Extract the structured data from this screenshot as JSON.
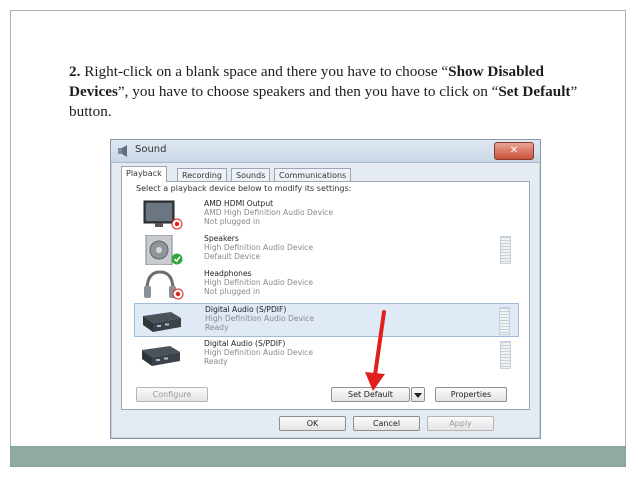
{
  "slide": {
    "caption": {
      "step_number": "2.",
      "part1": " Right-click on a blank space and there you have to choose “",
      "bold1": "Show Disabled Devices",
      "part2": "”, you have to choose speakers and then you have to click on “",
      "bold2": "Set Default",
      "part3": "” button."
    }
  },
  "dialog": {
    "title": "Sound",
    "close_label": "✕",
    "tabs": [
      {
        "label": "Playback",
        "active": true
      },
      {
        "label": "Recording",
        "active": false
      },
      {
        "label": "Sounds",
        "active": false
      },
      {
        "label": "Communications",
        "active": false
      }
    ],
    "instruction": "Select a playback device below to modify its settings:",
    "devices": [
      {
        "name": "AMD HDMI Output",
        "driver": "AMD High Definition Audio Device",
        "status": "Not plugged in",
        "icon": "monitor-icon",
        "badge": "red-down-arrow"
      },
      {
        "name": "Speakers",
        "driver": "High Definition Audio Device",
        "status": "Default Device",
        "icon": "speaker-icon",
        "badge": "green-check"
      },
      {
        "name": "Headphones",
        "driver": "High Definition Audio Device",
        "status": "Not plugged in",
        "icon": "headphones-icon",
        "badge": "red-down-arrow"
      },
      {
        "name": "Digital Audio (S/PDIF)",
        "driver": "High Definition Audio Device",
        "status": "Ready",
        "icon": "digital-audio-icon",
        "badge": "",
        "selected": true
      },
      {
        "name": "Digital Audio (S/PDIF)",
        "driver": "High Definition Audio Device",
        "status": "Ready",
        "icon": "digital-audio-icon",
        "badge": ""
      }
    ],
    "buttons": {
      "configure": "Configure",
      "set_default": "Set Default",
      "properties": "Properties",
      "ok": "OK",
      "cancel": "Cancel",
      "apply": "Apply"
    },
    "colors": {
      "annotation_arrow": "#e0201c",
      "close_button": "#c9503a",
      "default_badge": "#2fa83a"
    }
  }
}
